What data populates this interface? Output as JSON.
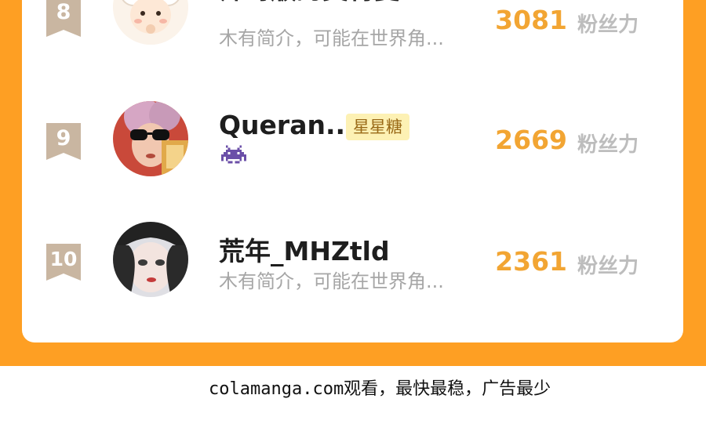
{
  "rows": [
    {
      "rank": "8",
      "name": "帅哥版的奥特曼",
      "desc": "木有简介，可能在世界角...",
      "count": "3081",
      "count_label": "粉丝力",
      "avatar": "sheep-avatar"
    },
    {
      "rank": "9",
      "name": "Queran...",
      "tag": "星星糖",
      "badge_icon": "space-invader-icon",
      "count": "2669",
      "count_label": "粉丝力",
      "avatar": "sunglasses-girl-avatar"
    },
    {
      "rank": "10",
      "name": "荒年_MHZtld",
      "desc": "木有简介，可能在世界角...",
      "count": "2361",
      "count_label": "粉丝力",
      "avatar": "anime-girl-avatar"
    }
  ],
  "footer": {
    "text": "colamanga.com观看，最快最稳，广告最少"
  },
  "colors": {
    "panel": "#fe9f23",
    "count": "#f2a533",
    "badge": "#c9b6a1",
    "tag_bg": "#fdf1b4",
    "tag_text": "#9a6a18"
  }
}
